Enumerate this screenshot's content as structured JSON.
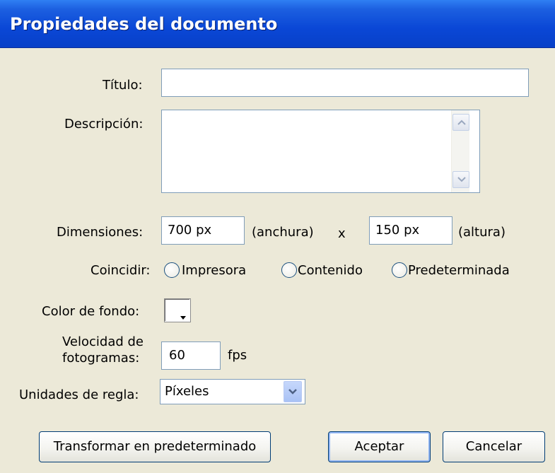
{
  "dialog": {
    "title": "Propiedades del documento"
  },
  "fields": {
    "titulo": {
      "label": "Título:",
      "value": ""
    },
    "descripcion": {
      "label": "Descripción:",
      "value": ""
    },
    "dimensiones": {
      "label": "Dimensiones:",
      "width_value": "700 px",
      "width_suffix": "(anchura)",
      "separator": "x",
      "height_value": "150 px",
      "height_suffix": "(altura)"
    },
    "coincidir": {
      "label": "Coincidir:",
      "options": [
        "Impresora",
        "Contenido",
        "Predeterminada"
      ],
      "selected": null
    },
    "color_fondo": {
      "label": "Color de fondo:",
      "value": "#ffffff"
    },
    "velocidad": {
      "label_line1": "Velocidad de",
      "label_line2": "fotogramas:",
      "value": "60",
      "unit": "fps"
    },
    "unidades": {
      "label": "Unidades de regla:",
      "value": "Píxeles"
    }
  },
  "buttons": {
    "make_default": "Transformar en predeterminado",
    "ok": "Aceptar",
    "cancel": "Cancelar"
  },
  "colors": {
    "titlebar": "#0a47d6",
    "background": "#ece9d8",
    "input_border": "#7f9db9"
  }
}
